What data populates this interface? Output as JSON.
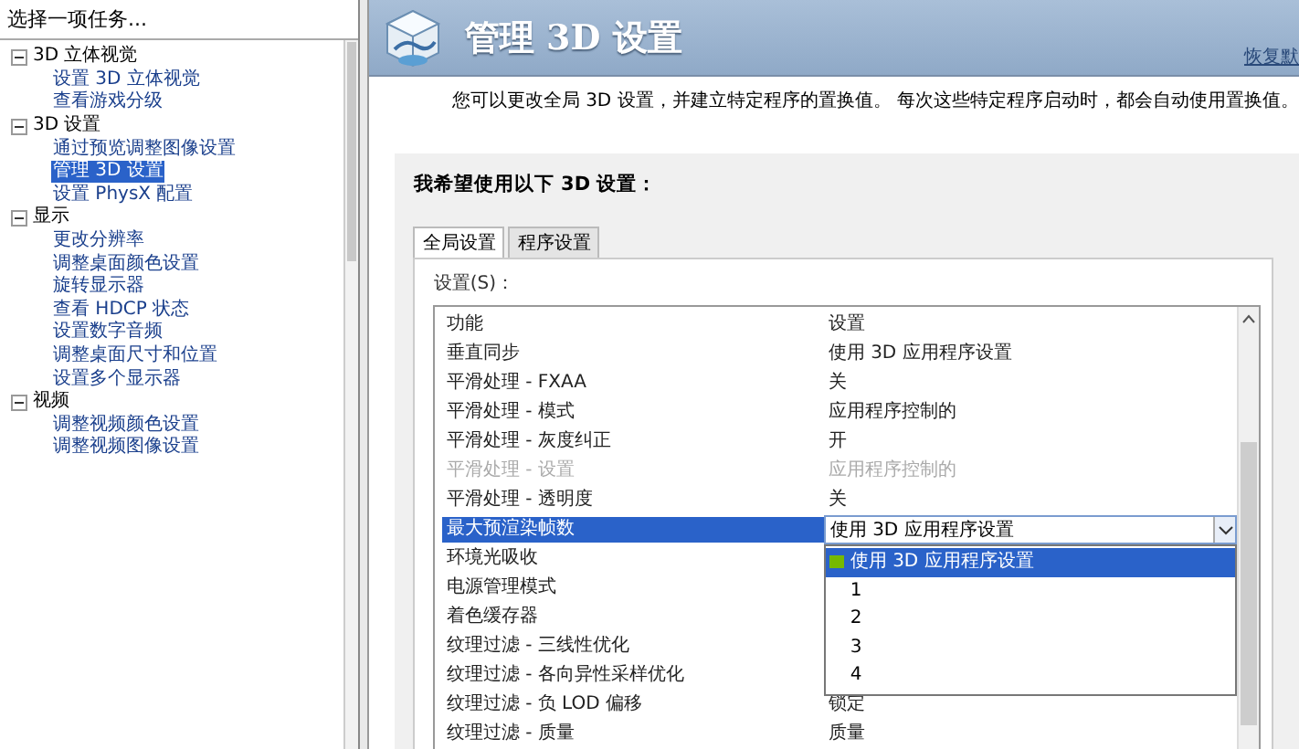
{
  "sidebar": {
    "title": "选择一项任务...",
    "tree": [
      {
        "label": "3D 立体视觉",
        "expanded": true,
        "selected": false,
        "children": [
          {
            "label": "设置 3D 立体视觉",
            "selected": false
          },
          {
            "label": "查看游戏分级",
            "selected": false
          }
        ]
      },
      {
        "label": "3D 设置",
        "expanded": true,
        "selected": false,
        "children": [
          {
            "label": "通过预览调整图像设置",
            "selected": false
          },
          {
            "label": "管理 3D 设置",
            "selected": true
          },
          {
            "label": "设置 PhysX 配置",
            "selected": false
          }
        ]
      },
      {
        "label": "显示",
        "expanded": true,
        "selected": false,
        "children": [
          {
            "label": "更改分辨率",
            "selected": false
          },
          {
            "label": "调整桌面颜色设置",
            "selected": false
          },
          {
            "label": "旋转显示器",
            "selected": false
          },
          {
            "label": "查看 HDCP 状态",
            "selected": false
          },
          {
            "label": "设置数字音频",
            "selected": false
          },
          {
            "label": "调整桌面尺寸和位置",
            "selected": false
          },
          {
            "label": "设置多个显示器",
            "selected": false
          }
        ]
      },
      {
        "label": "视频",
        "expanded": true,
        "selected": false,
        "children": [
          {
            "label": "调整视频颜色设置",
            "selected": false
          },
          {
            "label": "调整视频图像设置",
            "selected": false
          }
        ]
      }
    ]
  },
  "header": {
    "title": "管理 3D 设置",
    "restore_link": "恢复默"
  },
  "description": "您可以更改全局 3D 设置，并建立特定程序的置换值。 每次这些特定程序启动时，都会自动使用置换值。",
  "settings_panel": {
    "heading": "我希望使用以下 3D 设置：",
    "tabs": [
      {
        "label": "全局设置",
        "selected": true
      },
      {
        "label": "程序设置",
        "selected": false
      }
    ],
    "list_label": "设置(S)：",
    "table": {
      "columns": [
        "功能",
        "设置"
      ],
      "rows": [
        {
          "feature": "垂直同步",
          "value": "使用 3D 应用程序设置",
          "disabled": false,
          "selected": false
        },
        {
          "feature": "平滑处理 - FXAA",
          "value": "关",
          "disabled": false,
          "selected": false
        },
        {
          "feature": "平滑处理 - 模式",
          "value": "应用程序控制的",
          "disabled": false,
          "selected": false
        },
        {
          "feature": "平滑处理 - 灰度纠正",
          "value": "开",
          "disabled": false,
          "selected": false
        },
        {
          "feature": "平滑处理 - 设置",
          "value": "应用程序控制的",
          "disabled": true,
          "selected": false
        },
        {
          "feature": "平滑处理 - 透明度",
          "value": "关",
          "disabled": false,
          "selected": false
        },
        {
          "feature": "最大预渲染帧数",
          "value": "使用 3D 应用程序设置",
          "disabled": false,
          "selected": true,
          "dropdown": {
            "options": [
              {
                "label": "使用 3D 应用程序设置",
                "selected": true
              },
              {
                "label": "1",
                "selected": false
              },
              {
                "label": "2",
                "selected": false
              },
              {
                "label": "3",
                "selected": false
              },
              {
                "label": "4",
                "selected": false
              }
            ]
          }
        },
        {
          "feature": "环境光吸收",
          "disabled": false,
          "selected": false
        },
        {
          "feature": "电源管理模式",
          "disabled": false,
          "selected": false
        },
        {
          "feature": "着色缓存器",
          "disabled": false,
          "selected": false
        },
        {
          "feature": "纹理过滤 - 三线性优化",
          "disabled": false,
          "selected": false
        },
        {
          "feature": "纹理过滤 - 各向异性采样优化",
          "disabled": false,
          "selected": false
        },
        {
          "feature": "纹理过滤 - 负 LOD 偏移",
          "value": "锁定",
          "disabled": false,
          "selected": false
        },
        {
          "feature": "纹理过滤 - 质量",
          "value": "质量",
          "disabled": false,
          "selected": false
        }
      ]
    }
  }
}
